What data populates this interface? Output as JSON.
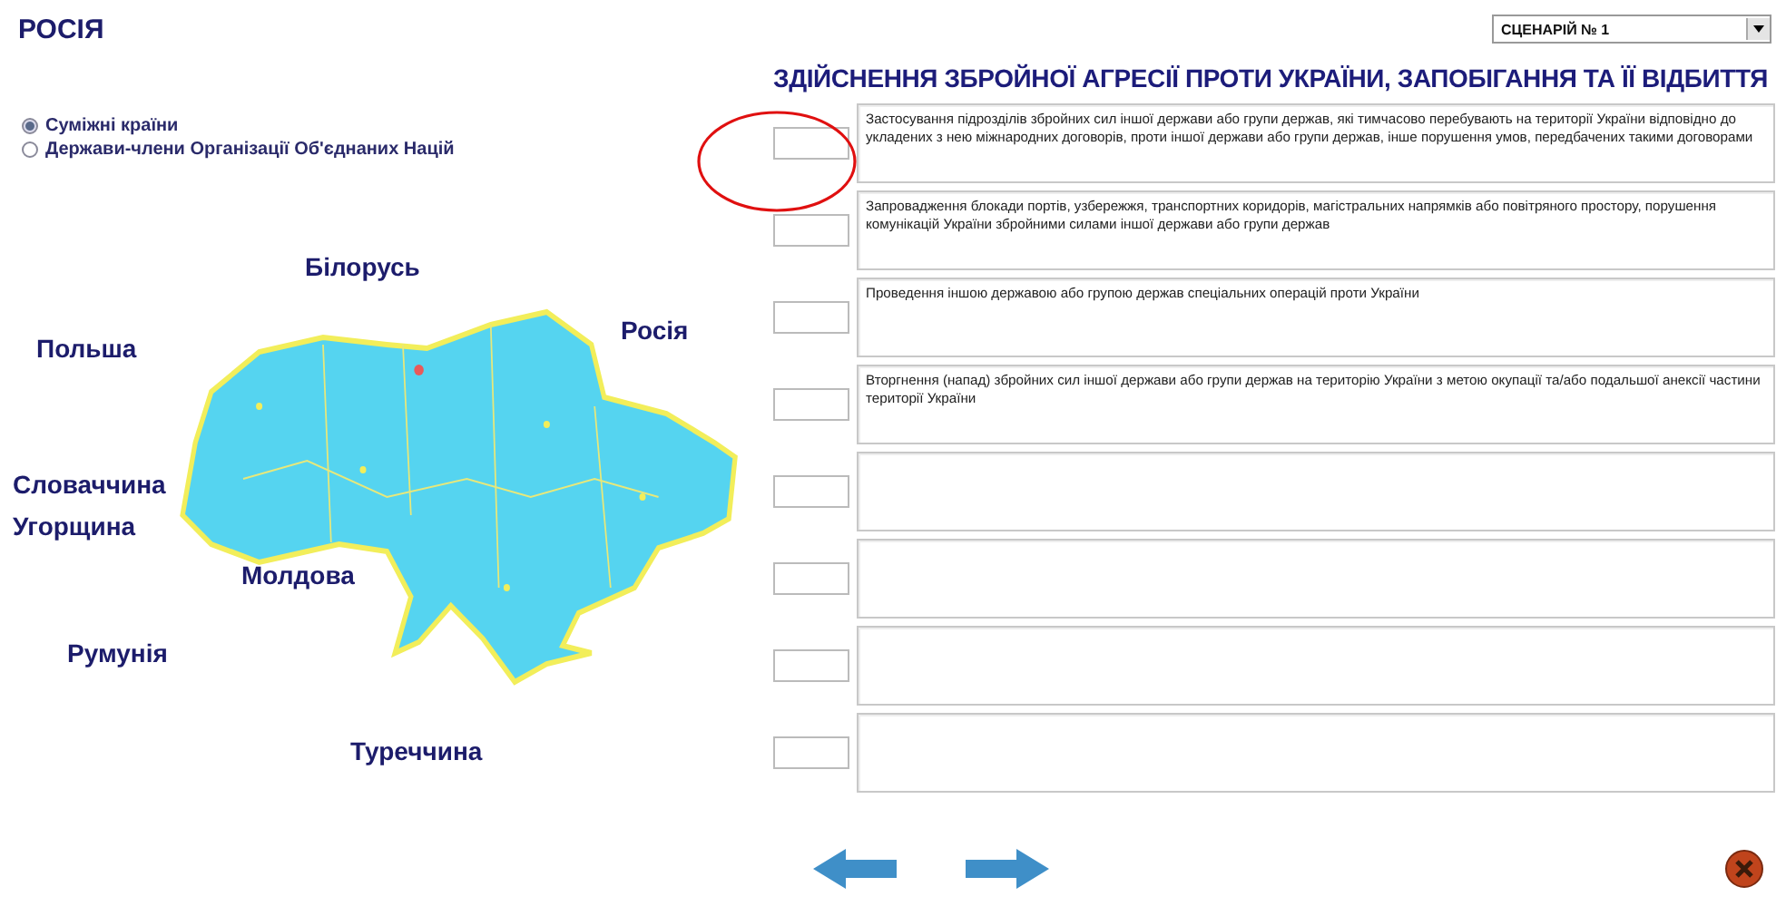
{
  "title": "РОСІЯ",
  "scenario_select": {
    "value": "СЦЕНАРІЙ № 1"
  },
  "heading": "ЗДІЙСНЕННЯ ЗБРОЙНОЇ АГРЕСІЇ ПРОТИ УКРАЇНИ, ЗАПОБІГАННЯ ТА ЇЇ ВІДБИТТЯ",
  "radio_options": [
    {
      "label": "Суміжні країни",
      "selected": true
    },
    {
      "label": "Держави-члени Організації Об'єднаних Націй",
      "selected": false
    }
  ],
  "map": {
    "kind": "picture",
    "countries": [
      {
        "label": "Білорусь"
      },
      {
        "label": "Польша"
      },
      {
        "label": "Росія"
      },
      {
        "label": "Словаччина"
      },
      {
        "label": "Угорщина"
      },
      {
        "label": "Молдова"
      },
      {
        "label": "Румунія"
      },
      {
        "label": "Туреччина"
      }
    ]
  },
  "rows": [
    {
      "kind": "text",
      "text": "Застосування підрозділів збройних сил іншої держави або групи держав, які тимчасово перебувають на території України відповідно до укладених з нею міжнародних договорів, проти іншої держави або групи держав, інше порушення умов, передбачених такими договорами"
    },
    {
      "kind": "text",
      "text": "Запровадження блокади портів, узбережжя, транспортних коридорів, магістральних напрямків або повітряного простору, порушення комунікацій України збройними силами іншої держави або групи держав"
    },
    {
      "kind": "text",
      "text": "Проведення іншою державою або групою держав спеціальних операцій проти України"
    },
    {
      "kind": "text",
      "text": "Вторгнення (напад) збройних сил іншої держави або групи держав на територію України з метою окупації та/або подальшої анексії частини території України"
    },
    {
      "kind": "blank"
    },
    {
      "kind": "blank"
    },
    {
      "kind": "blank"
    },
    {
      "kind": "blank"
    }
  ]
}
